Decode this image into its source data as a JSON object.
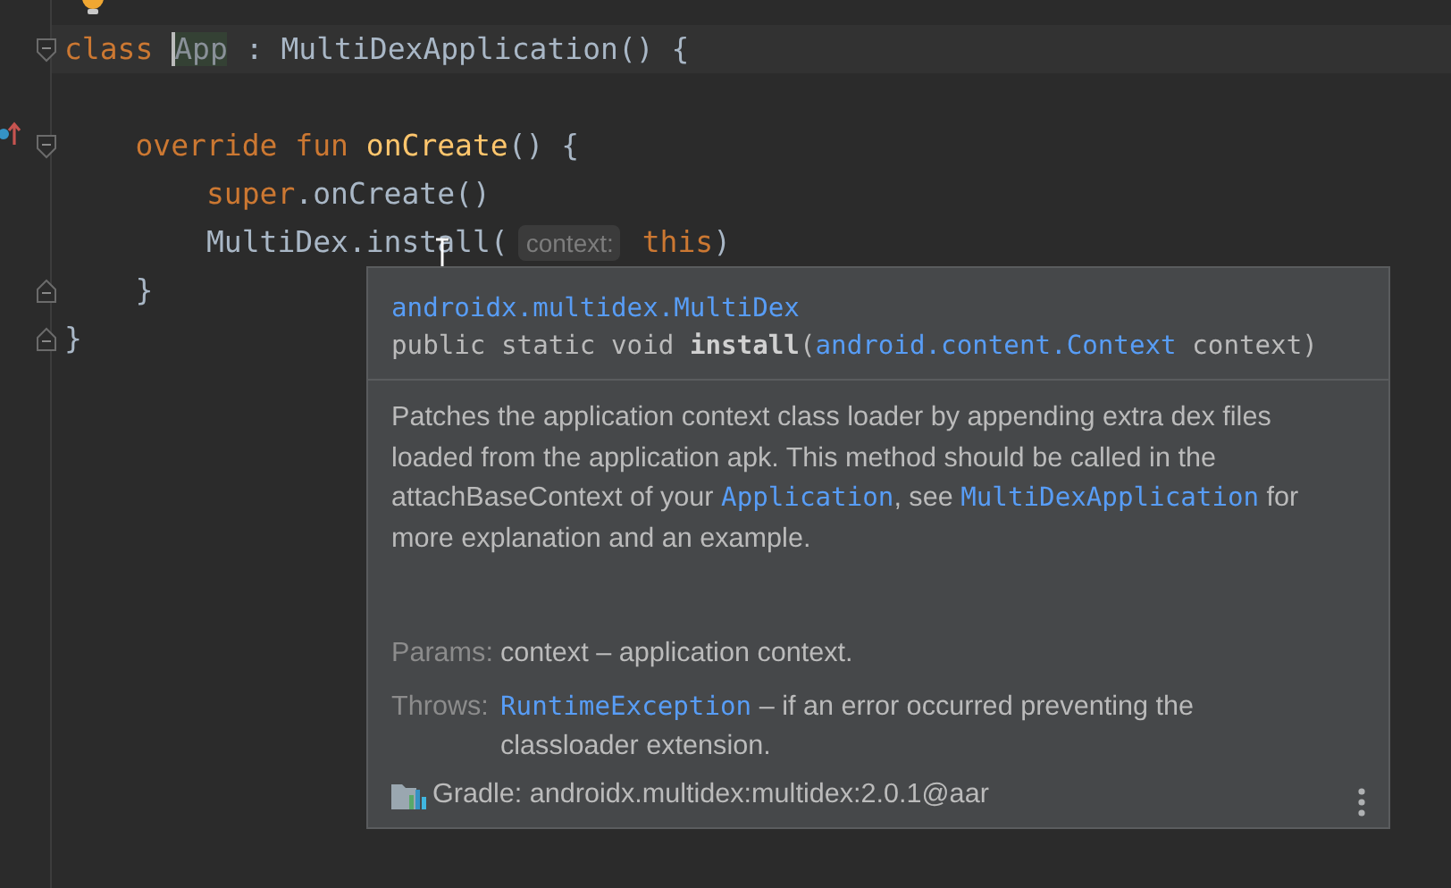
{
  "editor": {
    "lines": [
      {
        "fold_start": true,
        "current": true,
        "tokens": [
          {
            "text": "class ",
            "kind": "keyword"
          },
          {
            "text": "App",
            "kind": "usage"
          },
          {
            "text": " : MultiDexApplication() {",
            "kind": "plain"
          }
        ]
      },
      {
        "blank_line_before": true,
        "fold_start": true,
        "overridden": true,
        "tokens": [
          {
            "text": "    override fun ",
            "kind": "keyword"
          },
          {
            "text": "onCreate",
            "kind": "declaration"
          },
          {
            "text": "() {",
            "kind": "plain"
          }
        ]
      },
      {
        "tokens": [
          {
            "text": "        super",
            "kind": "keyword"
          },
          {
            "text": ".onCreate()",
            "kind": "plain"
          }
        ]
      },
      {
        "tokens": [
          {
            "text": "        MultiDex.install(",
            "kind": "plain"
          },
          {
            "text": "context:",
            "kind": "hint"
          },
          {
            "text": " this",
            "kind": "keyword"
          },
          {
            "text": ")",
            "kind": "plain"
          }
        ]
      },
      {
        "fold_end": true,
        "tokens": [
          {
            "text": "    }",
            "kind": "plain"
          }
        ]
      },
      {
        "fold_end": true,
        "tokens": [
          {
            "text": "}",
            "kind": "plain"
          }
        ]
      }
    ]
  },
  "doc": {
    "package": "androidx.multidex.MultiDex",
    "signature": [
      {
        "text": "public static void ",
        "kind": "plain"
      },
      {
        "text": "install",
        "kind": "bold"
      },
      {
        "text": "(",
        "kind": "plain"
      },
      {
        "text": "android.content.Context",
        "kind": "link"
      },
      {
        "text": " context)",
        "kind": "plain"
      }
    ],
    "description": [
      {
        "text": "Patches the application context class loader by appending extra dex files loaded from the application apk. This method should be called in the attachBaseContext of your ",
        "kind": "plain"
      },
      {
        "text": "Application",
        "kind": "link"
      },
      {
        "text": ", see ",
        "kind": "plain"
      },
      {
        "text": "MultiDexApplication",
        "kind": "link"
      },
      {
        "text": " for more explanation and an example.",
        "kind": "plain"
      }
    ],
    "sections": [
      {
        "label": "Params:",
        "parts": [
          {
            "text": "context – application context.",
            "kind": "plain"
          }
        ]
      },
      {
        "label": "Throws:",
        "parts": [
          {
            "text": "RuntimeException",
            "kind": "link"
          },
          {
            "text": " – if an error occurred preventing the classloader extension.",
            "kind": "plain"
          }
        ]
      }
    ],
    "source": "Gradle: androidx.multidex:multidex:2.0.1@aar"
  }
}
